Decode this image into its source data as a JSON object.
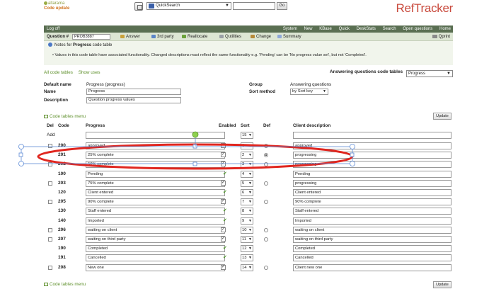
{
  "brand": {
    "line1": "altarama",
    "line2": "Code update"
  },
  "quicksearch": {
    "selected": "QuickSearch",
    "input_value": "",
    "go_label": "Go"
  },
  "logo": "RefTracker",
  "nav": {
    "left": "Log off",
    "items": [
      "System",
      "New",
      "KBase",
      "Quick",
      "DeskStats",
      "Search",
      "Open questions",
      "Home"
    ]
  },
  "qbar": {
    "label": "Question #",
    "number": "PROB3887",
    "actions": [
      "Answer",
      "3rd party",
      "Reallocate",
      "Qutilities",
      "Change",
      "Summary"
    ],
    "qprint": "Qprint"
  },
  "notes": {
    "title_pre": "Notes for ",
    "title_bold": "Progress",
    "title_post": " code table",
    "bullet": "• Values in this code table have associated functionality. Changed descriptions must reflect the same functionality e.g. 'Pending' can be 'No progress value set', but not 'Completed'."
  },
  "links": {
    "all": "All code tables",
    "show": "Show uses"
  },
  "answering": {
    "label": "Answering questions code tables",
    "selected": "Progress"
  },
  "meta": {
    "default_name_label": "Default name",
    "default_name": "Progress (progress)",
    "name_label": "Name",
    "name": "Progress",
    "description_label": "Description",
    "description": "Question progress values",
    "group_label": "Group",
    "group": "Answering questions",
    "sort_label": "Sort method",
    "sort": "by Sort key"
  },
  "menu_label": "Code tables menu",
  "update_label": "Update",
  "table": {
    "headers": {
      "del": "Del",
      "code": "Code",
      "progress": "Progress",
      "enabled": "Enabled",
      "sort": "Sort",
      "def": "Def",
      "client": "Client description"
    },
    "add_label": "Add",
    "add_sort": "15",
    "rows": [
      {
        "code": "200",
        "del": true,
        "progress": "approved",
        "enabled": "box",
        "sort": "1",
        "def": "off",
        "client": "approved"
      },
      {
        "code": "201",
        "del": false,
        "progress": "25% complete",
        "enabled": "box",
        "sort": "2",
        "def": "on",
        "client": "progressing"
      },
      {
        "code": "202",
        "del": true,
        "progress": "50% complete",
        "enabled": "box",
        "sort": "3",
        "def": "off",
        "client": "progressing"
      },
      {
        "code": "100",
        "del": false,
        "progress": "Pending",
        "enabled": "tick",
        "sort": "4",
        "def": "none",
        "client": "Pending"
      },
      {
        "code": "203",
        "del": true,
        "progress": "75% complete",
        "enabled": "box",
        "sort": "5",
        "def": "off",
        "client": "progressing"
      },
      {
        "code": "120",
        "del": false,
        "progress": "Client entered",
        "enabled": "tick",
        "sort": "6",
        "def": "none",
        "client": "Client entered"
      },
      {
        "code": "205",
        "del": true,
        "progress": "90% complete",
        "enabled": "box",
        "sort": "7",
        "def": "off",
        "client": "90% complete"
      },
      {
        "code": "130",
        "del": false,
        "progress": "Staff entered",
        "enabled": "tick",
        "sort": "8",
        "def": "none",
        "client": "Staff entered"
      },
      {
        "code": "140",
        "del": false,
        "progress": "Imported",
        "enabled": "tick",
        "sort": "9",
        "def": "none",
        "client": "Imported"
      },
      {
        "code": "206",
        "del": true,
        "progress": "waiting on client",
        "enabled": "box",
        "sort": "10",
        "def": "off",
        "client": "waiting on client"
      },
      {
        "code": "207",
        "del": true,
        "progress": "waiting on third party",
        "enabled": "box",
        "sort": "11",
        "def": "off",
        "client": "waiting on third party"
      },
      {
        "code": "190",
        "del": false,
        "progress": "Completed",
        "enabled": "tick",
        "sort": "12",
        "def": "none",
        "client": "Completed"
      },
      {
        "code": "191",
        "del": false,
        "progress": "Cancelled",
        "enabled": "tick",
        "sort": "13",
        "def": "none",
        "client": "Cancelled"
      },
      {
        "code": "208",
        "del": true,
        "progress": "New one",
        "enabled": "box",
        "sort": "14",
        "def": "off",
        "client": "Client new one"
      }
    ]
  }
}
